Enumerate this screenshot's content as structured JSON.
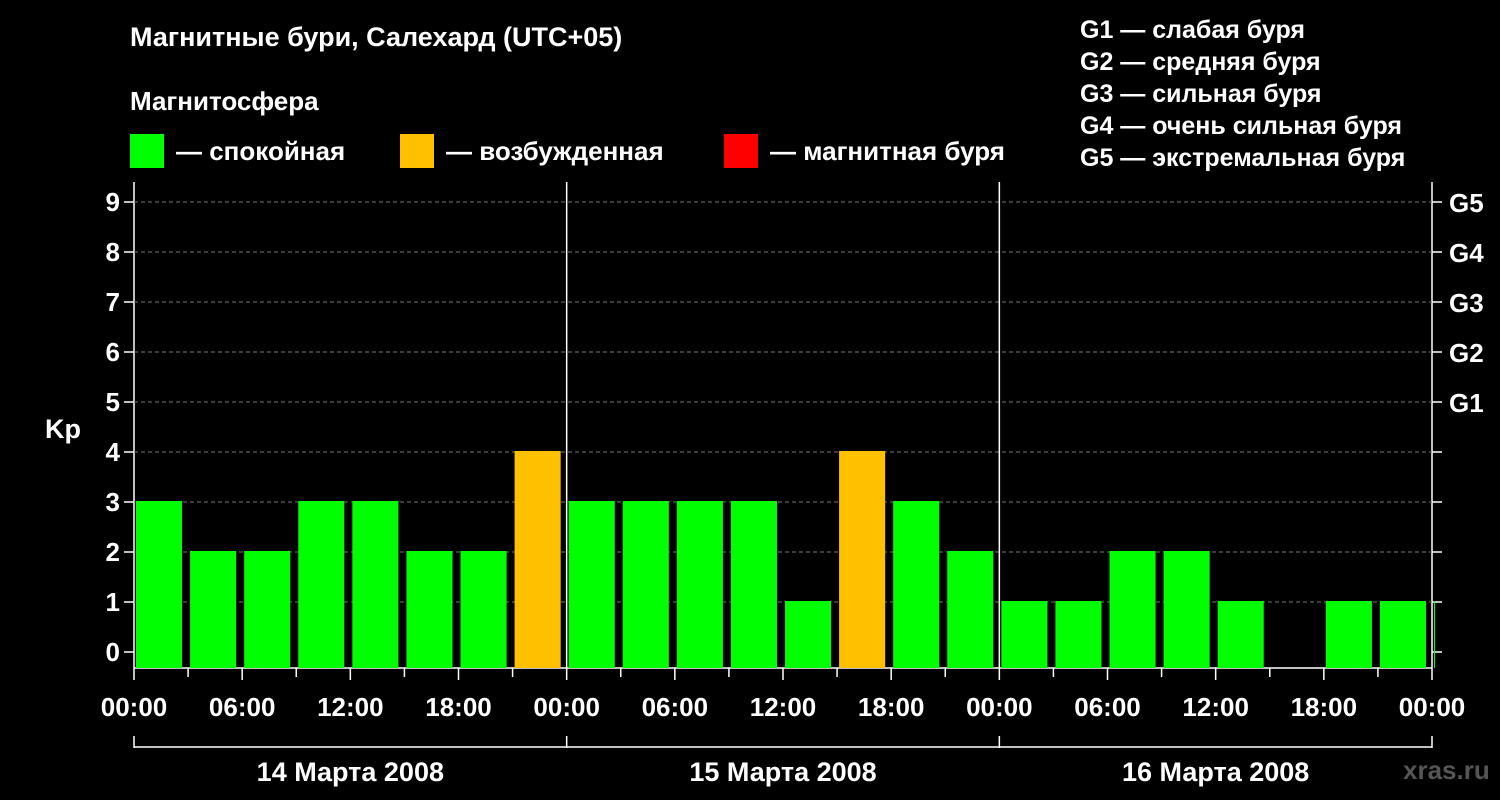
{
  "header": {
    "title": "Магнитные бури, Салехард (UTC+05)",
    "subtitle": "Магнитосфера",
    "watermark": "xras.ru"
  },
  "legend": [
    {
      "label": "— спокойная",
      "color": "#00ff00"
    },
    {
      "label": "— возбужденная",
      "color": "#ffc000"
    },
    {
      "label": "— магнитная буря",
      "color": "#ff0000"
    }
  ],
  "storm_levels": [
    "G1 — слабая буря",
    "G2 — средняя буря",
    "G3 — сильная буря",
    "G4 — очень сильная буря",
    "G5 — экстремальная буря"
  ],
  "chart_data": {
    "type": "bar",
    "ylabel": "Kp",
    "ylim": [
      0,
      9
    ],
    "yticks": [
      "0",
      "1",
      "2",
      "3",
      "4",
      "5",
      "6",
      "7",
      "8",
      "9"
    ],
    "right_ticks": [
      {
        "value": 5,
        "label": "G1"
      },
      {
        "value": 6,
        "label": "G2"
      },
      {
        "value": 7,
        "label": "G3"
      },
      {
        "value": 8,
        "label": "G4"
      },
      {
        "value": 9,
        "label": "G5"
      }
    ],
    "x_tick_labels": [
      "00:00",
      "06:00",
      "12:00",
      "18:00",
      "00:00",
      "06:00",
      "12:00",
      "18:00",
      "00:00",
      "06:00",
      "12:00",
      "18:00",
      "00:00"
    ],
    "days": [
      "14 Марта 2008",
      "15 Марта 2008",
      "16 Марта 2008"
    ],
    "interval_hours": 3,
    "values": [
      3,
      2,
      2,
      3,
      3,
      2,
      2,
      4,
      3,
      3,
      3,
      3,
      1,
      4,
      3,
      2,
      1,
      1,
      2,
      2,
      1,
      0,
      1,
      1,
      1
    ],
    "colors": {
      "quiet": "#00ff00",
      "active": "#ffc000",
      "storm": "#ff0000"
    },
    "grid": true
  }
}
